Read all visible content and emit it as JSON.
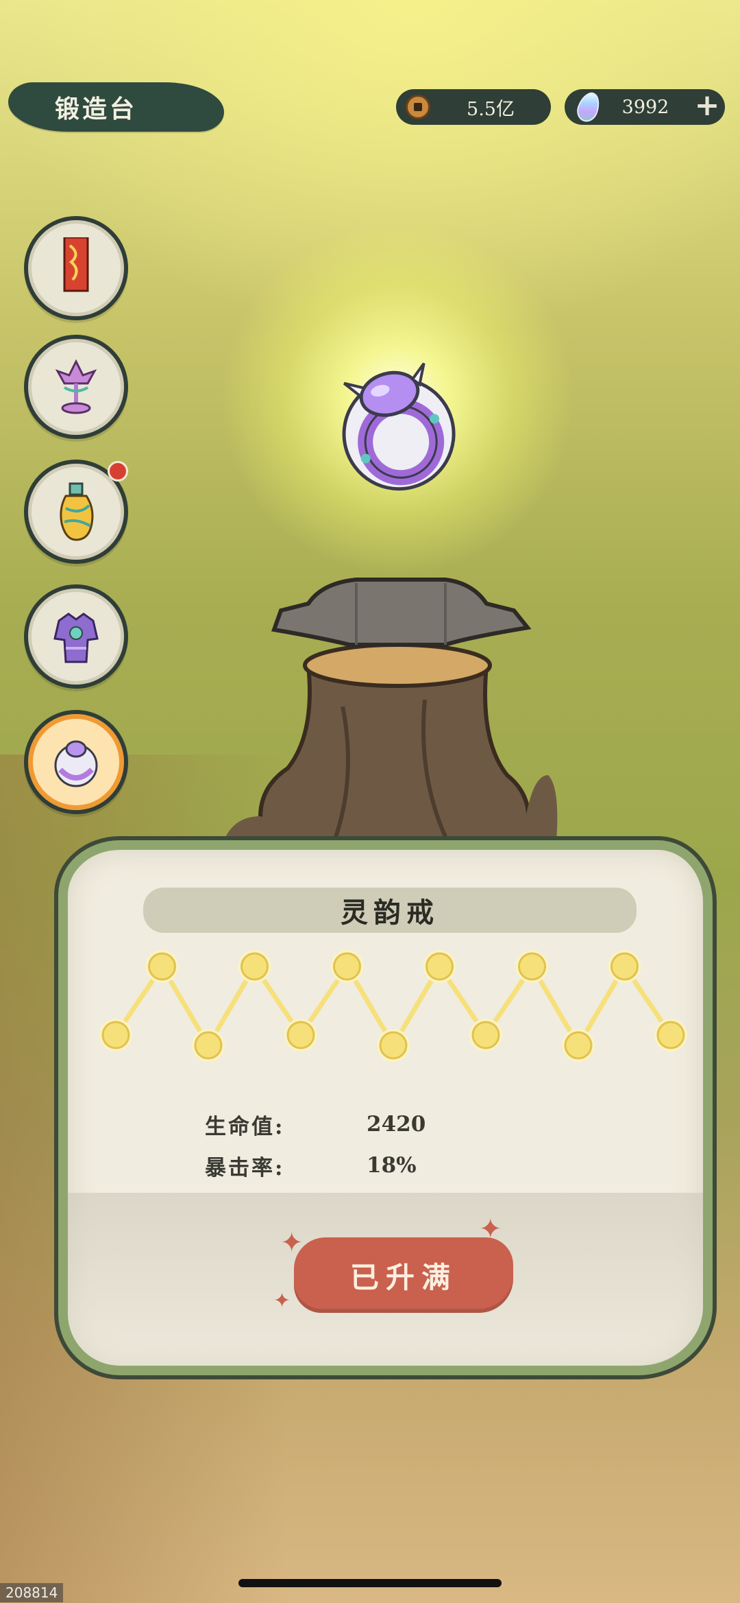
{
  "header": {
    "title": "锻造台",
    "coins": "5.5亿",
    "gems": "3992",
    "coin_icon": "coin-icon",
    "gem_icon": "crystal-icon",
    "plus_label": "+"
  },
  "sidebar": {
    "items": [
      {
        "name": "talisman-slot",
        "icon": "talisman-icon",
        "selected": false
      },
      {
        "name": "lotus-lamp-slot",
        "icon": "lotus-lamp-icon",
        "selected": false
      },
      {
        "name": "gourd-slot",
        "icon": "gourd-icon",
        "selected": false,
        "badge": true
      },
      {
        "name": "armor-slot",
        "icon": "armor-icon",
        "selected": false
      },
      {
        "name": "ring-slot",
        "icon": "ring-icon",
        "selected": true
      }
    ]
  },
  "item": {
    "name": "灵韵戒",
    "level_nodes_total": 13,
    "level_nodes_filled": 13,
    "stats": [
      {
        "label": "生命值:",
        "value": "2420"
      },
      {
        "label": "暴击率:",
        "value": "18%"
      }
    ],
    "action_label": "已升满"
  },
  "footer": {
    "build_id": "208814"
  },
  "colors": {
    "accent_dark": "#2f3e36",
    "button_red": "#c9614e",
    "panel_border": "#8fa56e",
    "node_gold": "#f6e07a"
  }
}
